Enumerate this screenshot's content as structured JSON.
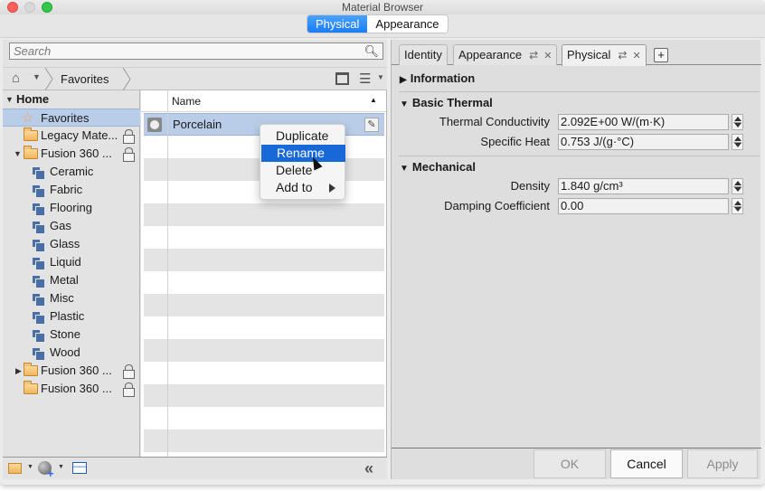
{
  "window": {
    "title": "Material Browser",
    "mode_tabs": [
      {
        "label": "Physical",
        "active": true
      },
      {
        "label": "Appearance",
        "active": false
      }
    ]
  },
  "left": {
    "search": {
      "placeholder": "Search",
      "value": ""
    },
    "breadcrumb": {
      "home_icon": "home-icon",
      "current": "Favorites"
    },
    "tree": {
      "root": "Home",
      "items": [
        {
          "label": "Favorites",
          "icon": "star-icon",
          "selected": true
        },
        {
          "label": "Legacy Mate...",
          "icon": "folder-icon",
          "locked": true
        },
        {
          "label": "Fusion 360 ...",
          "icon": "folder-icon",
          "locked": true,
          "expanded": true
        },
        {
          "label": "Ceramic",
          "icon": "library-icon"
        },
        {
          "label": "Fabric",
          "icon": "library-icon"
        },
        {
          "label": "Flooring",
          "icon": "library-icon"
        },
        {
          "label": "Gas",
          "icon": "library-icon"
        },
        {
          "label": "Glass",
          "icon": "library-icon"
        },
        {
          "label": "Liquid",
          "icon": "library-icon"
        },
        {
          "label": "Metal",
          "icon": "library-icon"
        },
        {
          "label": "Misc",
          "icon": "library-icon"
        },
        {
          "label": "Plastic",
          "icon": "library-icon"
        },
        {
          "label": "Stone",
          "icon": "library-icon"
        },
        {
          "label": "Wood",
          "icon": "library-icon"
        },
        {
          "label": "Fusion 360 ...",
          "icon": "folder-icon",
          "locked": true,
          "collapsed": true
        },
        {
          "label": "Fusion 360 ...",
          "icon": "folder-icon",
          "locked": true
        }
      ]
    },
    "list": {
      "column_header": "Name",
      "rows": [
        {
          "name": "Porcelain",
          "selected": true
        }
      ]
    }
  },
  "context_menu": {
    "items": [
      {
        "label": "Duplicate"
      },
      {
        "label": "Rename",
        "highlighted": true
      },
      {
        "label": "Delete"
      },
      {
        "label": "Add to",
        "submenu": true
      }
    ]
  },
  "right": {
    "tabs": [
      {
        "label": "Identity"
      },
      {
        "label": "Appearance",
        "closable": true
      },
      {
        "label": "Physical",
        "closable": true,
        "active": true
      }
    ],
    "sections": [
      {
        "title": "Information",
        "expanded": false,
        "properties": []
      },
      {
        "title": "Basic Thermal",
        "expanded": true,
        "properties": [
          {
            "label": "Thermal Conductivity",
            "value": "2.092E+00 W/(m·K)"
          },
          {
            "label": "Specific Heat",
            "value": "0.753 J/(g·°C)"
          }
        ]
      },
      {
        "title": "Mechanical",
        "expanded": true,
        "properties": [
          {
            "label": "Density",
            "value": "1.840 g/cm³"
          },
          {
            "label": "Damping Coefficient",
            "value": "0.00"
          }
        ]
      }
    ],
    "buttons": {
      "ok": "OK",
      "cancel": "Cancel",
      "apply": "Apply"
    }
  },
  "colors": {
    "accent": "#1b7cf4",
    "selection": "#b9cde9",
    "menu_highlight": "#1869d8"
  }
}
